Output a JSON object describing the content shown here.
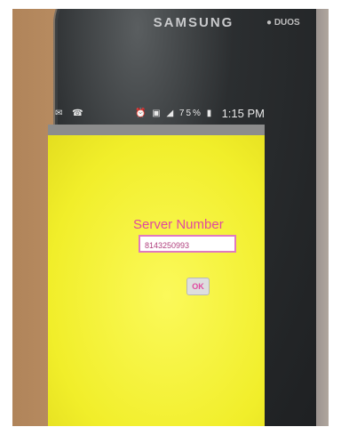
{
  "device": {
    "brand": "SAMSUNG",
    "model_badge": "● DUOS"
  },
  "status_bar": {
    "left_icons": "✉ ☎",
    "right_icons": "⏰ ▣ ◢ 75% ▮",
    "time": "1:15 PM"
  },
  "dialog": {
    "title": "Server Number",
    "field_value": "8143250993",
    "ok_label": "OK"
  },
  "colors": {
    "screen_background": "#f1ee2a",
    "accent_text": "#e04aa0"
  }
}
